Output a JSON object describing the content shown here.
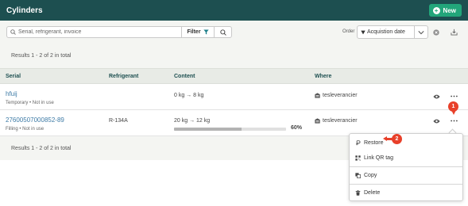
{
  "header": {
    "title": "Cylinders",
    "new_label": "New"
  },
  "toolbar": {
    "search_placeholder": "Serial, refrigerant, invoice",
    "filter_label": "Filter",
    "order_label": "Order",
    "order_value": "Acquistion date"
  },
  "results_text": "Results 1 - 2 of 2 in total",
  "table": {
    "columns": [
      "Serial",
      "Refrigerant",
      "Content",
      "Where"
    ],
    "rows": [
      {
        "serial": "hfuij",
        "status": "Temporary • Not in use",
        "refrigerant": "",
        "content": "0 kg → 8 kg",
        "where": "tesleverancier"
      },
      {
        "serial": "27600507000852-89",
        "status": "Filling • Not in use",
        "refrigerant": "R-134A",
        "content": "20 kg → 12 kg",
        "fill_percent": 60,
        "fill_percent_label": "60%",
        "where": "tesleverancier"
      }
    ]
  },
  "context_menu": {
    "items": [
      "Restore",
      "Link QR tag",
      "Copy",
      "Delete"
    ]
  },
  "annotations": {
    "marker_1": "1",
    "marker_2": "2"
  },
  "colors": {
    "header_bg": "#1d4f50",
    "new_button": "#22a67a",
    "link": "#3e7ba6",
    "marker": "#e8402a"
  }
}
